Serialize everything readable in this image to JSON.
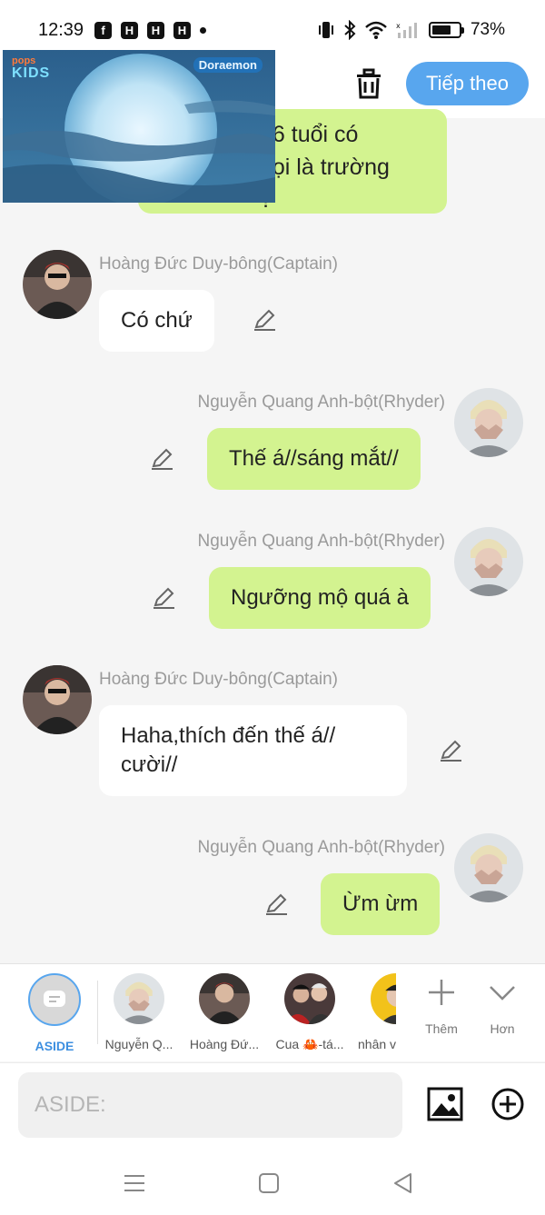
{
  "status_bar": {
    "time": "12:39",
    "battery_pct": "73%",
    "battery_level": 0.73,
    "notification_icons": [
      "facebook-icon",
      "h-app-icon",
      "h-app-icon",
      "h-app-icon"
    ],
    "system_icons": [
      "vibrate-icon",
      "bluetooth-icon",
      "wifi-icon",
      "signal-icon",
      "battery-icon"
    ]
  },
  "header": {
    "next_label": "Tiếp theo",
    "delete_icon": "trash-icon"
  },
  "video": {
    "brand_left_top": "pops",
    "brand_left_bottom": "KIDS",
    "brand_right": "Doraemon"
  },
  "chat": {
    "top_partial_text": "16 tuổi có\ngọi là trường\n?",
    "messages": [
      {
        "sender": "Hoàng Đức Duy-bông(Captain)",
        "text": "Có chứ",
        "side": "in"
      },
      {
        "sender": "Nguyễn Quang Anh-bột(Rhyder)",
        "text": "Thế á//sáng mắt//",
        "side": "out"
      },
      {
        "sender": "Nguyễn Quang Anh-bột(Rhyder)",
        "text": "Ngưỡng mộ quá à",
        "side": "out"
      },
      {
        "sender": "Hoàng Đức Duy-bông(Captain)",
        "text": "Haha,thích đến thế á//\ncười//",
        "side": "in"
      },
      {
        "sender": "Nguyễn Quang Anh-bột(Rhyder)",
        "text": "Ừm ừm",
        "side": "out"
      }
    ]
  },
  "participants": {
    "items": [
      {
        "label": "ASIDE",
        "active": true
      },
      {
        "label": "Nguyễn Q..."
      },
      {
        "label": "Hoàng Đứ..."
      },
      {
        "label": "Cua 🦀-tá..."
      },
      {
        "label": "nhân v"
      }
    ],
    "add_label": "Thêm",
    "more_label": "Hơn"
  },
  "composer": {
    "placeholder": "ASIDE:"
  },
  "colors": {
    "accent": "#58a6ee",
    "outgoing_bubble": "#d3f390",
    "incoming_bubble": "#ffffff",
    "background": "#f5f5f5"
  }
}
